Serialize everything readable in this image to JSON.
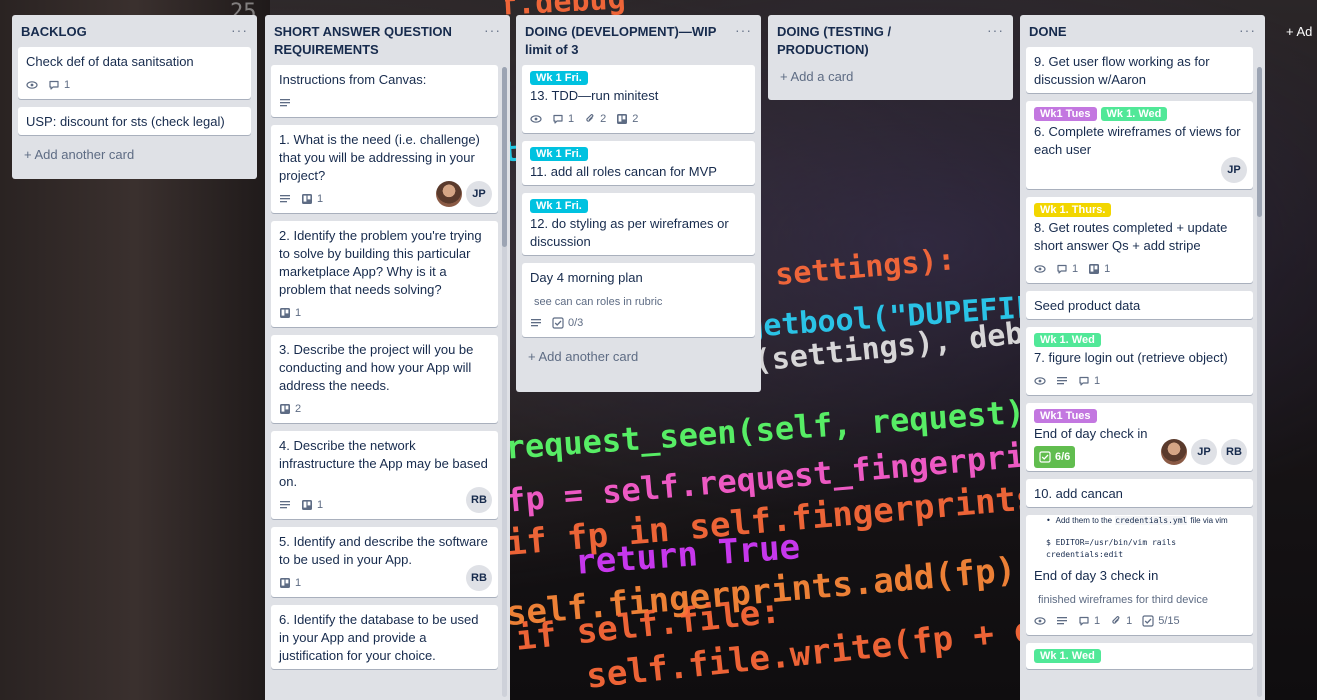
{
  "background": {
    "left_number": "25",
    "code_lines": [
      {
        "text": "self.debug",
        "color": "#ff6b3a"
      },
      {
        "text": "nts.update(s",
        "color": "#1fd3f0"
      },
      {
        "text": "settings):",
        "color": "#ff6b3a"
      },
      {
        "text": "getbool(\"DUPEFIL",
        "color": "#2ad1f5"
      },
      {
        "text": "r(settings), debu",
        "color": "#e6e6e6"
      },
      {
        "text": "request_seen(self, request):",
        "color": "#5cff6b"
      },
      {
        "text": "fp = self.request_fingerprint(re",
        "color": "#ff5fd2"
      },
      {
        "text": "if fp in self.fingerprints:",
        "color": "#ff6b3a"
      },
      {
        "text": "return True",
        "color": "#d63bff"
      },
      {
        "text": "self.fingerprints.add(fp)",
        "color": "#ff8a3a"
      },
      {
        "text": "if self.file:",
        "color": "#ff6b3a"
      },
      {
        "text": "self.file.write(fp + os.lin",
        "color": "#ff6b3a"
      }
    ]
  },
  "colors": {
    "label_cyan": "#00c2e0",
    "label_purple": "#c377e0",
    "label_green": "#51e898",
    "label_yellow": "#f2d600",
    "check_complete": "#61bd4f"
  },
  "add_list_label": "+ Ad",
  "lists": [
    {
      "title": "BACKLOG",
      "menu": "···",
      "add_label": "+ Add another card",
      "cards": [
        {
          "title": "Check def of data sanitsation",
          "watch": true,
          "comments": "1"
        },
        {
          "title": "USP: discount for sts (check legal)"
        }
      ]
    },
    {
      "title": "SHORT ANSWER QUESTION REQUIREMENTS",
      "menu": "···",
      "cards": [
        {
          "title": "Instructions from Canvas:",
          "desc": true
        },
        {
          "title": "1. What is the need (i.e. challenge) that you will be addressing in your project?",
          "desc": true,
          "trello": "1",
          "members": [
            "photo",
            "JP"
          ]
        },
        {
          "title": "2. Identify the problem you're trying to solve by building this particular marketplace App? Why is it a problem that needs solving?",
          "trello": "1"
        },
        {
          "title": "3. Describe the project will you be conducting and how your App will address the needs.",
          "trello": "2"
        },
        {
          "title": "4. Describe the network infrastructure the App may be based on.",
          "desc": true,
          "trello": "1",
          "members": [
            "RB"
          ]
        },
        {
          "title": "5. Identify and describe the software to be used in your App.",
          "trello": "1",
          "members": [
            "RB"
          ]
        },
        {
          "title": "6. Identify the database to be used in your App and provide a justification for your choice."
        }
      ]
    },
    {
      "title": "DOING (DEVELOPMENT)—WIP limit of 3",
      "menu": "···",
      "add_label": "+ Add another card",
      "cards": [
        {
          "label": "Wk 1 Fri.",
          "labelColor": "#00c2e0",
          "title": "13. TDD—run minitest",
          "watch": true,
          "comments": "1",
          "attach": "2",
          "trello": "2"
        },
        {
          "label": "Wk 1 Fri.",
          "labelColor": "#00c2e0",
          "title": "11. add all roles cancan for MVP"
        },
        {
          "label": "Wk 1 Fri.",
          "labelColor": "#00c2e0",
          "title": "12. do styling as per wireframes or discussion"
        },
        {
          "title": "Day 4 morning plan",
          "subtext": "see can can roles in rubric",
          "desc": true,
          "checklist": "0/3"
        }
      ]
    },
    {
      "title": "DOING (TESTING / PRODUCTION)",
      "menu": "···",
      "add_label": "+ Add a card",
      "cards": []
    },
    {
      "title": "DONE",
      "menu": "···",
      "cards": [
        {
          "title": "9. Get user flow working as for discussion w/Aaron"
        },
        {
          "labels": [
            {
              "text": "Wk1 Tues",
              "color": "#c377e0"
            },
            {
              "text": "Wk 1. Wed",
              "color": "#51e898"
            }
          ],
          "title": "6. Complete wireframes of views for each user",
          "members": [
            "JP"
          ]
        },
        {
          "labels": [
            {
              "text": "Wk 1. Thurs.",
              "color": "#f2d600"
            }
          ],
          "title": "8. Get routes completed + update short answer Qs + add stripe",
          "watch": true,
          "comments": "1",
          "trello": "1"
        },
        {
          "title": "Seed product data"
        },
        {
          "labels": [
            {
              "text": "Wk 1. Wed",
              "color": "#51e898"
            }
          ],
          "title": "7. figure login out (retrieve object)",
          "watch": true,
          "desc": true,
          "comments": "1"
        },
        {
          "labels": [
            {
              "text": "Wk1 Tues",
              "color": "#c377e0"
            }
          ],
          "title": "End of day check in",
          "checklist_done": "6/6",
          "members": [
            "photo",
            "JP",
            "RB"
          ]
        },
        {
          "title": "10. add cancan"
        },
        {
          "snippet_bullet": "Add them to the",
          "snippet_code": "credentials.yml",
          "snippet_tail": "file via vim",
          "snippet_cmd": "$ EDITOR=/usr/bin/vim rails credentials:edit",
          "title": "End of day 3 check in",
          "subtext": "finished wireframes for third device",
          "watch": true,
          "desc": true,
          "comments": "1",
          "attach": "1",
          "checklist": "5/15"
        },
        {
          "labels": [
            {
              "text": "Wk 1. Wed",
              "color": "#51e898"
            }
          ],
          "title": ""
        }
      ]
    }
  ]
}
